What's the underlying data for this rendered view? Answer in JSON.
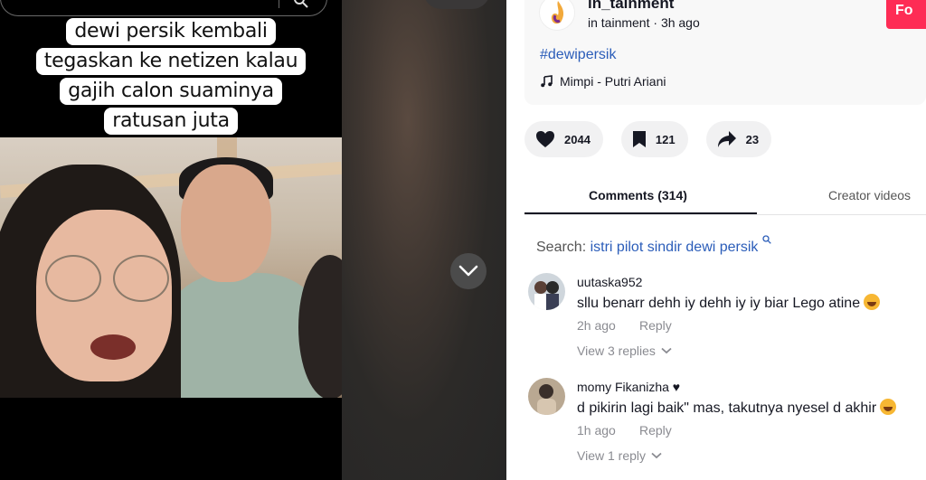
{
  "video": {
    "caption_lines": [
      "dewi persik kembali",
      "tegaskan ke netizen kalau",
      "gajih calon suaminya",
      "ratusan juta"
    ]
  },
  "author": {
    "username": "in_tainment",
    "display_name": "in tainment",
    "time_ago": "3h ago",
    "follow_label": "Fo"
  },
  "post": {
    "hashtag": "#dewipersik",
    "music": "Mimpi - Putri Ariani"
  },
  "actions": {
    "likes": "2044",
    "saves": "121",
    "shares": "23"
  },
  "tabs": {
    "comments": "Comments (314)",
    "creator_videos": "Creator videos"
  },
  "related_search": {
    "label": "Search:",
    "query": "istri pilot sindir dewi persik"
  },
  "comments": [
    {
      "user": "uutaska952",
      "text": "sllu benarr dehh iy dehh iy iy biar Lego atine",
      "time": "2h ago",
      "reply_label": "Reply",
      "view_replies": "View 3 replies"
    },
    {
      "user": "momy Fikanizha ♥",
      "text": "d pikirin lagi baik\" mas, takutnya nyesel d akhir",
      "time": "1h ago",
      "reply_label": "Reply",
      "view_replies": "View 1 reply"
    }
  ],
  "colors": {
    "accent": "#fe2c55",
    "link": "#2b5db9",
    "muted": "#8a8b91"
  }
}
